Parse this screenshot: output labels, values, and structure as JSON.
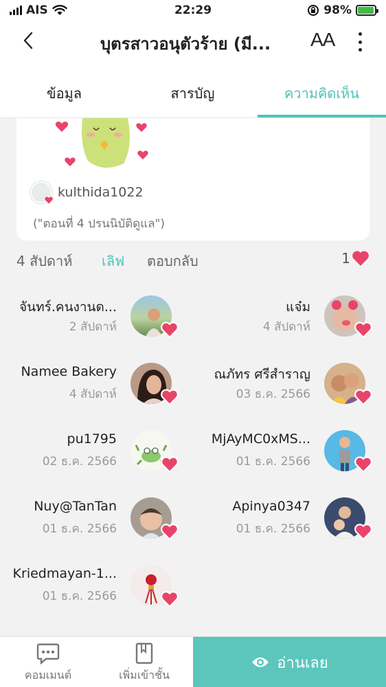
{
  "status_bar": {
    "carrier": "AIS",
    "time": "22:29",
    "battery": "98%"
  },
  "header": {
    "title": "บุตรสาวอนุตัวร้าย (มี...",
    "font_button": "AA"
  },
  "tabs": [
    {
      "label": "ข้อมูล",
      "active": false
    },
    {
      "label": "สารบัญ",
      "active": false
    },
    {
      "label": "ความคิดเห็น",
      "active": true
    }
  ],
  "comment": {
    "username": "kulthida1022",
    "quote": "(\"ตอนที่ 4 ปรนนิบัติดูแล\")",
    "time_ago": "4 สัปดาห์",
    "like_label": "เลิฟ",
    "reply_label": "ตอบกลับ",
    "like_count": "1"
  },
  "likers": [
    {
      "name": "จันทร์.คนงานด...",
      "date": "2 สัปดาห์"
    },
    {
      "name": "แจ๋ม",
      "date": "4 สัปดาห์"
    },
    {
      "name": "Namee Bakery",
      "date": "4 สัปดาห์"
    },
    {
      "name": "ณภัทร ศรีสำราญ",
      "date": "03 ธ.ค. 2566"
    },
    {
      "name": "pu1795",
      "date": "02 ธ.ค. 2566"
    },
    {
      "name": "MjAyMC0xMS...",
      "date": "01 ธ.ค. 2566"
    },
    {
      "name": "Nuy@TanTan",
      "date": "01 ธ.ค. 2566"
    },
    {
      "name": "Apinya0347",
      "date": "01 ธ.ค. 2566"
    },
    {
      "name": "Kriedmayan-1...",
      "date": "01 ธ.ค. 2566"
    }
  ],
  "bottom_bar": {
    "comment_label": "คอมเมนต์",
    "library_label": "เพิ่มเข้าชั้น",
    "read_label": "อ่านเลย"
  },
  "colors": {
    "accent": "#4fc4b9",
    "read_button": "#5cc6bd",
    "heart": "#e8446a"
  }
}
